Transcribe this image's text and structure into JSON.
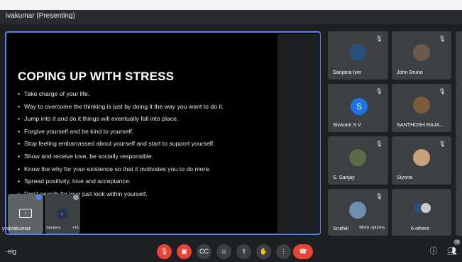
{
  "window": {
    "title": "ivakumar (Presenting)"
  },
  "slide": {
    "title": "COPING UP WITH STRESS",
    "bullets": [
      "Take charge of your life.",
      "Way to overcome the thinking is just by doing it the way you want to do it.",
      "Jump into it and do it things will eventually fall into place.",
      "Forgive yourself and be kind to yourself.",
      "Stop feeling embarrassed about yourself and start to support yourself.",
      "Show and receive love, be socially responsible.",
      "Know the why for your existence so that it motivates you to do more.",
      "Spread positivity, love and acceptance.",
      "Don't search for love just look within yourself."
    ]
  },
  "self_thumbs": {
    "presenter_label": "y sivakumar",
    "second_name": "Sanjana",
    "second_count": "+16"
  },
  "participants": [
    {
      "name": "Sanjana Iyer",
      "avatar": "photo"
    },
    {
      "name": "John Bruno",
      "avatar": "photo"
    },
    {
      "name": "Sivaram S V",
      "avatar": "letter",
      "letter": "S"
    },
    {
      "name": "SANTHOSH RAJA...",
      "avatar": "photo"
    },
    {
      "name": "S. Sanjay",
      "avatar": "photo"
    },
    {
      "name": "Siyona",
      "avatar": "photo"
    },
    {
      "name": "Sruthiii",
      "avatar": "photo",
      "overlay": "More options"
    },
    {
      "name": "6 others",
      "avatar": "group"
    }
  ],
  "bottom": {
    "meeting_code": "-eig",
    "people_badge": "18"
  },
  "colors": {
    "accent": "#4f86f7",
    "danger": "#ea4335",
    "tile": "#3c4043"
  },
  "icons": [
    "mic-off-icon",
    "camera-off-icon",
    "captions-icon",
    "emoji-icon",
    "present-icon",
    "raise-hand-icon",
    "more-vert-icon",
    "end-call-icon",
    "info-icon",
    "people-icon"
  ]
}
